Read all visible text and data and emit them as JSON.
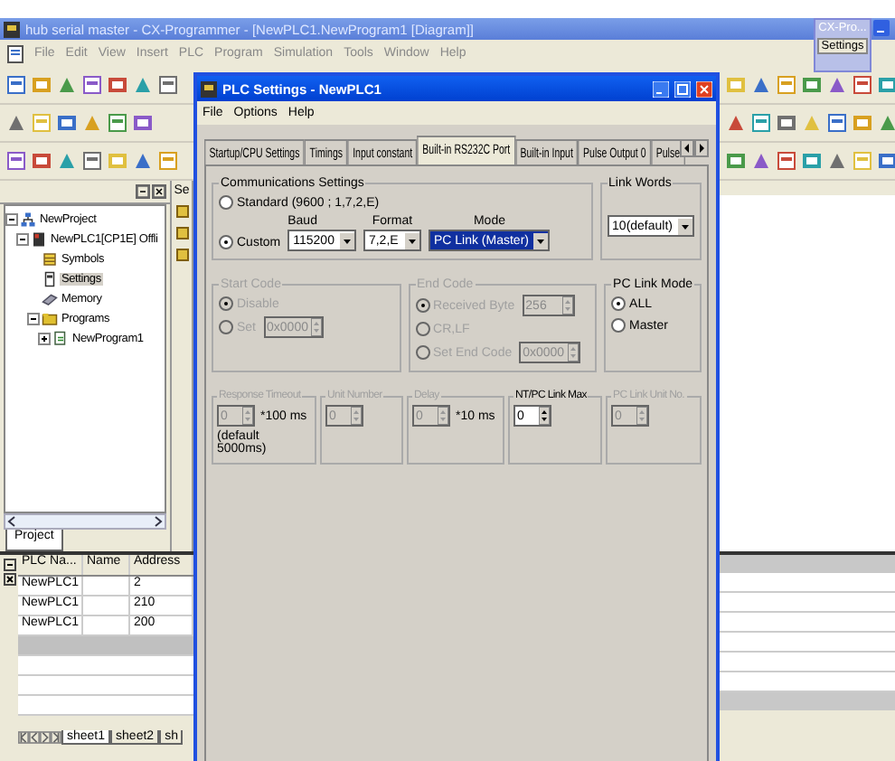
{
  "main_window": {
    "title": "hub serial master - CX-Programmer - [NewPLC1.NewProgram1 [Diagram]]",
    "menu": [
      "File",
      "Edit",
      "View",
      "Insert",
      "PLC",
      "Program",
      "Simulation",
      "Tools",
      "Window",
      "Help"
    ]
  },
  "taskbar_tooltip": {
    "title": "CX-Pro...",
    "button": "Settings"
  },
  "project_pane": {
    "tab": "Project",
    "tree": [
      {
        "label": "NewProject",
        "selected": false,
        "expanded": true,
        "children": [
          {
            "label": "NewPLC1[CP1E] Offli",
            "selected": false,
            "expanded": true,
            "children": [
              {
                "label": "Symbols",
                "selected": false
              },
              {
                "label": "Settings",
                "selected": true
              },
              {
                "label": "Memory",
                "selected": false
              },
              {
                "label": "Programs",
                "selected": false,
                "expanded": true,
                "children": [
                  {
                    "label": "NewProgram1",
                    "selected": false,
                    "expanded": false
                  }
                ]
              }
            ]
          }
        ]
      }
    ]
  },
  "side_panel": {
    "header": "Se"
  },
  "output_table": {
    "columns": [
      "PLC Na...",
      "Name",
      "Address"
    ],
    "rows": [
      {
        "plc": "NewPLC1",
        "address": "2"
      },
      {
        "plc": "NewPLC1",
        "address": "210"
      },
      {
        "plc": "NewPLC1",
        "address": "200"
      }
    ],
    "sheets": [
      {
        "label": "sheet1",
        "selected": true
      },
      {
        "label": "sheet2",
        "selected": false
      },
      {
        "label": "sh",
        "selected": false
      }
    ]
  },
  "dialog": {
    "title": "PLC Settings - NewPLC1",
    "menu": [
      "File",
      "Options",
      "Help"
    ],
    "tabs": [
      {
        "label": "Startup/CPU Settings",
        "selected": false
      },
      {
        "label": "Timings",
        "selected": false
      },
      {
        "label": "Input constant",
        "selected": false
      },
      {
        "label": "Built-in RS232C Port",
        "selected": true
      },
      {
        "label": "Built-in Input",
        "selected": false
      },
      {
        "label": "Pulse Output 0",
        "selected": false
      },
      {
        "label": "Pulse",
        "selected": false
      }
    ],
    "communications": {
      "title": "Communications Settings",
      "disabled": false,
      "options": [
        {
          "label": "Standard (9600 ; 1,7,2,E)",
          "selected": false
        },
        {
          "label": "Custom",
          "selected": true
        }
      ],
      "fields": [
        {
          "label": "Baud",
          "value": "115200",
          "focused": false
        },
        {
          "label": "Format",
          "value": "7,2,E",
          "focused": false
        },
        {
          "label": "Mode",
          "value": "PC Link (Master)",
          "focused": true
        }
      ]
    },
    "link_words": {
      "title": "Link Words",
      "value": "10(default)"
    },
    "start_code": {
      "title": "Start Code",
      "disabled": true,
      "options": [
        {
          "label": "Disable",
          "selected": true
        },
        {
          "label": "Set",
          "selected": false,
          "spinner": "0x0000"
        }
      ]
    },
    "end_code": {
      "title": "End Code",
      "disabled": true,
      "options": [
        {
          "label": "Received Byte",
          "selected": true,
          "spinner": "256"
        },
        {
          "label": "CR,LF",
          "selected": false
        },
        {
          "label": "Set End Code",
          "selected": false,
          "spinner": "0x0000"
        }
      ]
    },
    "pc_link_mode": {
      "title": "PC Link Mode",
      "disabled": false,
      "options": [
        {
          "label": "ALL",
          "selected": true
        },
        {
          "label": "Master",
          "selected": false
        }
      ]
    },
    "bottom_groups": [
      {
        "title": "Response Timeout",
        "value": "0",
        "unit": "*100 ms",
        "note": "(default 5000ms)",
        "disabled": true
      },
      {
        "title": "Unit Number",
        "value": "0",
        "disabled": true
      },
      {
        "title": "Delay",
        "value": "0",
        "unit": "*10 ms",
        "disabled": true
      },
      {
        "title": "NT/PC Link Max",
        "value": "0",
        "disabled": false
      },
      {
        "title": "PC Link Unit No.",
        "value": "0",
        "disabled": true
      }
    ]
  }
}
